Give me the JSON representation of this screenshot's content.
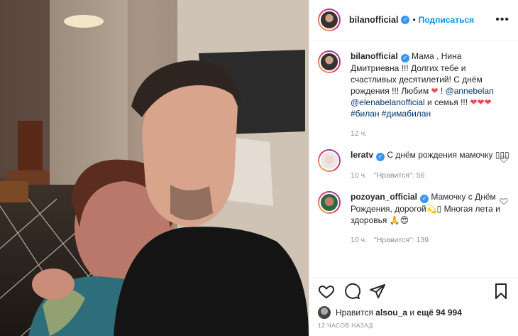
{
  "post": {
    "author": "bilanofficial",
    "follow_label": "Подписаться",
    "more_label": "•••",
    "separator": "•"
  },
  "caption": {
    "username": "bilanofficial",
    "text_1": "Мама , Нина Дмитриевна !!! Долгих тебе и счастливых десятилетий! С днём рождения !!! Любим ",
    "heart": "❤",
    "text_2": " ! ",
    "mention_1": "@annebelan",
    "mention_2": "@elenabelanofficial",
    "text_3": " и семья !!! ",
    "hearts": "❤❤❤",
    "hashtags": "#билан #димабилан",
    "time": "12 ч."
  },
  "comments": [
    {
      "username": "leratv",
      "text": "С днём рождения мамочку ▯▯▯",
      "time": "10 ч.",
      "likes": "\"Нравится\": 56"
    },
    {
      "username": "pozoyan_official",
      "text": "Мамочку с Днём Рождения, дорогой💫▯ Многая лета и здоровья 🙏😍",
      "time": "10 ч.",
      "likes": "\"Нравится\": 139"
    }
  ],
  "likes_line": {
    "prefix": "Нравится",
    "user": "alsou_a",
    "middle": "и",
    "count": "ещё 94 994"
  },
  "timestamp": "12 ЧАСОВ НАЗАД",
  "icons": [
    "heart-icon",
    "comment-icon",
    "share-icon",
    "bookmark-icon",
    "verified-icon"
  ],
  "colors": {
    "accent": "#0095f6",
    "verified": "#3897f0",
    "heart": "#ed4956"
  }
}
